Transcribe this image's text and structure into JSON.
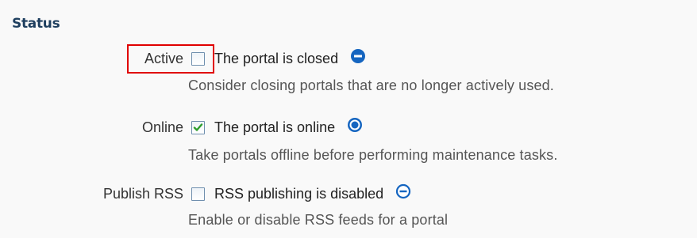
{
  "section": {
    "title": "Status"
  },
  "fields": [
    {
      "label": "Active",
      "checked": false,
      "value_text": "The portal is closed",
      "icon": "minus-circle-filled-icon",
      "hint": "Consider closing portals that are no longer actively used.",
      "highlighted": true
    },
    {
      "label": "Online",
      "checked": true,
      "value_text": "The portal is online",
      "icon": "dot-circle-icon",
      "hint": "Take portals offline before performing maintenance tasks.",
      "highlighted": false
    },
    {
      "label": "Publish RSS",
      "checked": false,
      "value_text": "RSS publishing is disabled",
      "icon": "minus-circle-outline-icon",
      "hint": "Enable or disable RSS feeds for a portal",
      "highlighted": false
    }
  ],
  "colors": {
    "heading": "#1f3f5f",
    "icon_blue": "#1565c0",
    "check_green": "#2e9e2e",
    "highlight_red": "#e00000",
    "checkbox_border": "#6f8fae"
  }
}
